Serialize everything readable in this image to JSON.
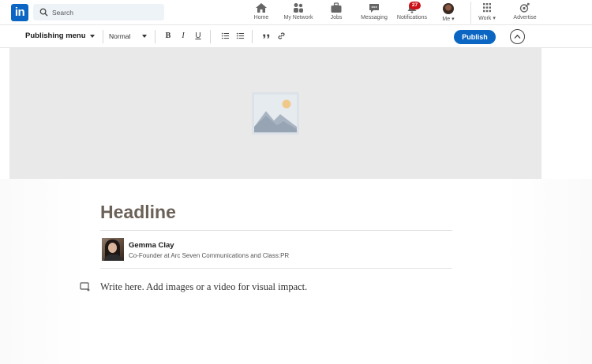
{
  "nav": {
    "logo_text": "in",
    "search_placeholder": "Search",
    "items": [
      {
        "label": "Home",
        "icon": "home-icon"
      },
      {
        "label": "My Network",
        "icon": "network-icon"
      },
      {
        "label": "Jobs",
        "icon": "briefcase-icon"
      },
      {
        "label": "Messaging",
        "icon": "message-icon"
      },
      {
        "label": "Notifications",
        "icon": "bell-icon",
        "badge": "27"
      },
      {
        "label": "Me",
        "icon": "avatar"
      },
      {
        "label": "Work",
        "icon": "grid-icon"
      },
      {
        "label": "Advertise",
        "icon": "advertise-icon"
      }
    ]
  },
  "toolbar": {
    "menu_label": "Publishing menu",
    "style_label": "Normal",
    "publish_label": "Publish"
  },
  "article": {
    "headline_placeholder": "Headline",
    "author_name": "Gemma Clay",
    "author_title": "Co-Founder at Arc Seven Communications and Class:PR",
    "body_placeholder": "Write here. Add images or a video for visual impact."
  },
  "colors": {
    "brand": "#0a66c2",
    "badge": "#cc1016",
    "headline": "#6b6158",
    "cover_bg": "#e9e9e9"
  }
}
